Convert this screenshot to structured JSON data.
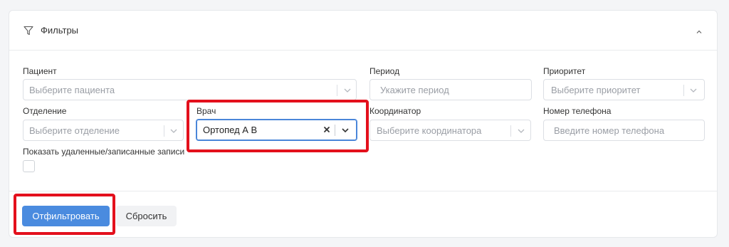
{
  "header": {
    "title": "Фильтры"
  },
  "fields": {
    "patient": {
      "label": "Пациент",
      "placeholder": "Выберите пациента"
    },
    "period": {
      "label": "Период",
      "placeholder": "Укажите период"
    },
    "priority": {
      "label": "Приоритет",
      "placeholder": "Выберите приоритет"
    },
    "department": {
      "label": "Отделение",
      "placeholder": "Выберите отделение"
    },
    "doctor": {
      "label": "Врач",
      "value": "Ортопед А В"
    },
    "coordinator": {
      "label": "Координатор",
      "placeholder": "Выберите координатора"
    },
    "phone": {
      "label": "Номер телефона",
      "placeholder": "Введите номер телефона"
    },
    "show_deleted": {
      "label": "Показать удаленные/записанные записи",
      "checked": false
    }
  },
  "actions": {
    "filter_label": "Отфильтровать",
    "reset_label": "Сбросить"
  },
  "colors": {
    "primary": "#4a8bdf",
    "highlight": "#e3101c",
    "focus_border": "#4a86d9"
  },
  "icons": {
    "header": "filter-icon",
    "collapse": "chevron-up-icon",
    "dropdown": "chevron-down-icon",
    "clear": "clear-icon"
  }
}
